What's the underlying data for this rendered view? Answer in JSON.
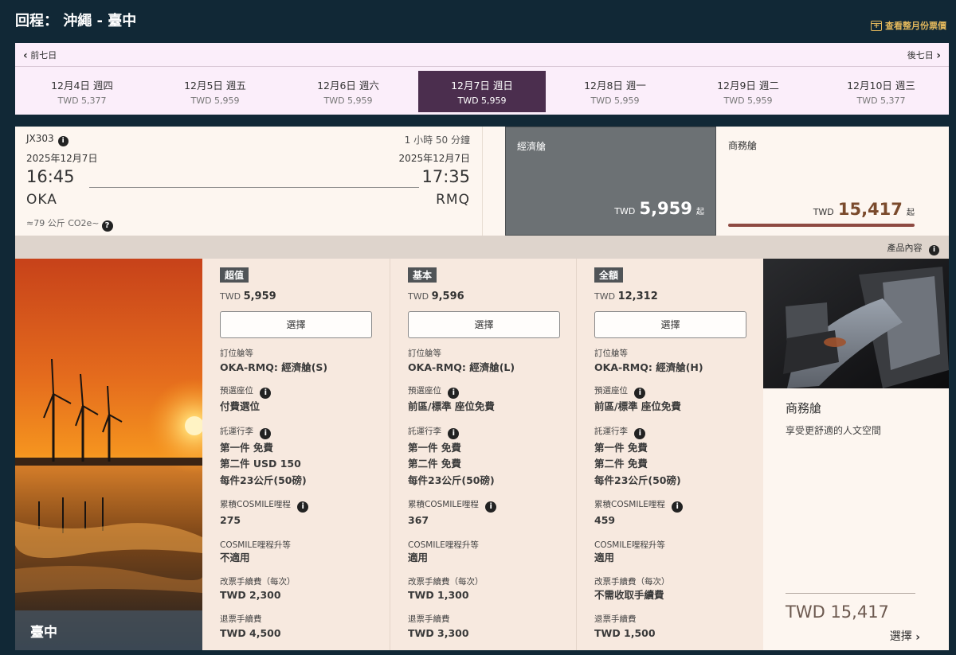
{
  "header": {
    "route_title": "回程： 沖繩 - 臺中",
    "monthly_link": "查看整月份票價"
  },
  "week_nav": {
    "prev_label": "前七日",
    "next_label": "後七日"
  },
  "dates": [
    {
      "date": "12月4日 週四",
      "price": "TWD 5,377",
      "active": false
    },
    {
      "date": "12月5日 週五",
      "price": "TWD 5,959",
      "active": false
    },
    {
      "date": "12月6日 週六",
      "price": "TWD 5,959",
      "active": false
    },
    {
      "date": "12月7日 週日",
      "price": "TWD 5,959",
      "active": true
    },
    {
      "date": "12月8日 週一",
      "price": "TWD 5,959",
      "active": false
    },
    {
      "date": "12月9日 週二",
      "price": "TWD 5,959",
      "active": false
    },
    {
      "date": "12月10日 週三",
      "price": "TWD 5,377",
      "active": false
    }
  ],
  "flight": {
    "number": "JX303",
    "duration": "1 小時 50 分鐘",
    "dep_date": "2025年12月7日",
    "arr_date": "2025年12月7日",
    "dep_time": "16:45",
    "arr_time": "17:35",
    "dep_code": "OKA",
    "arr_code": "RMQ",
    "co2": "≈79 公斤 CO2e~"
  },
  "cabins": {
    "economy": {
      "name": "經濟艙",
      "currency": "TWD",
      "price": "5,959",
      "suffix": "起"
    },
    "business": {
      "name": "商務艙",
      "currency": "TWD",
      "price": "15,417",
      "suffix": "起"
    }
  },
  "product_info_label": "產品內容",
  "photo_caption": "臺中",
  "labels": {
    "booking_class": "訂位艙等",
    "seat": "預選座位",
    "baggage": "託運行李",
    "miles": "累積COSMILE哩程",
    "upgrade": "COSMILE哩程升等",
    "change_fee": "改票手續費（每次）",
    "refund_fee": "退票手續費",
    "select": "選擇"
  },
  "fares": [
    {
      "name": "超值",
      "currency": "TWD",
      "price": "5,959",
      "booking_class": "OKA-RMQ: 經濟艙(S)",
      "seat": "付費選位",
      "bag1": "第一件 免費",
      "bag2": "第二件 USD 150",
      "bag3": "每件23公斤(50磅)",
      "miles": "275",
      "upgrade": "不適用",
      "change_fee": "TWD 2,300",
      "refund_fee": "TWD 4,500"
    },
    {
      "name": "基本",
      "currency": "TWD",
      "price": "9,596",
      "booking_class": "OKA-RMQ: 經濟艙(L)",
      "seat": "前區/標準 座位免費",
      "bag1": "第一件 免費",
      "bag2": "第二件 免費",
      "bag3": "每件23公斤(50磅)",
      "miles": "367",
      "upgrade": "適用",
      "change_fee": "TWD 1,300",
      "refund_fee": "TWD 3,300"
    },
    {
      "name": "全額",
      "currency": "TWD",
      "price": "12,312",
      "booking_class": "OKA-RMQ: 經濟艙(H)",
      "seat": "前區/標準 座位免費",
      "bag1": "第一件 免費",
      "bag2": "第二件 免費",
      "bag3": "每件23公斤(50磅)",
      "miles": "459",
      "upgrade": "適用",
      "change_fee": "不需收取手續費",
      "refund_fee": "TWD 1,500"
    }
  ],
  "business_promo": {
    "title": "商務艙",
    "subtitle": "享受更舒適的人文空間",
    "price": "TWD 15,417",
    "select_label": "選擇"
  },
  "icons": {
    "calendar": "calendar-plus-icon",
    "info": "info-icon",
    "help": "question-icon",
    "chevron_left": "chevron-left-icon",
    "chevron_right": "chevron-right-icon"
  },
  "colors": {
    "background": "#112836",
    "active_date": "#4b2e4e",
    "economy_selected": "#6c7174",
    "business_bar": "#8e4a42",
    "accent_gold": "#e3b85c"
  }
}
